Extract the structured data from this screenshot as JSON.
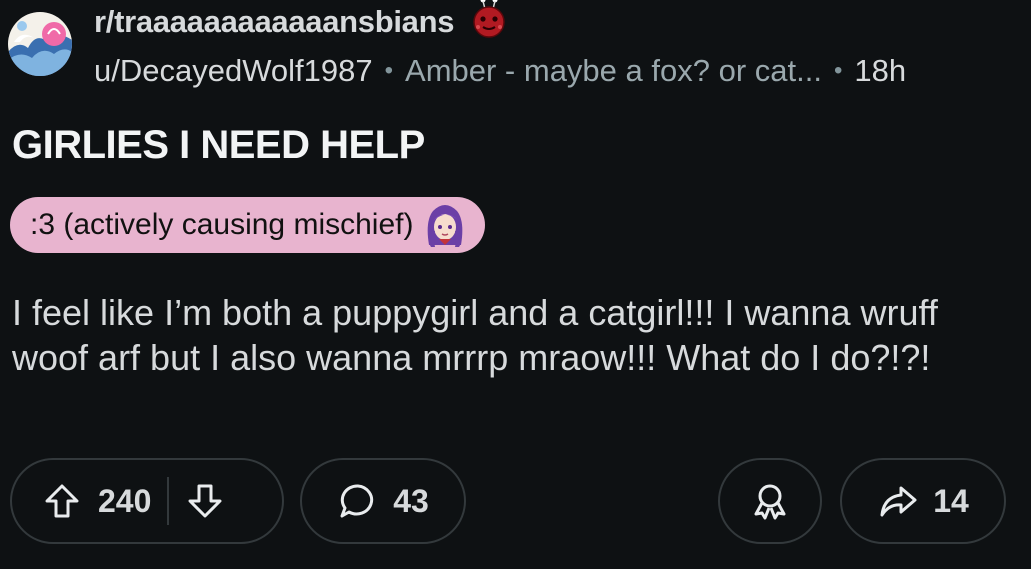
{
  "header": {
    "subreddit": "r/traaaaaaaaaaaansbians",
    "username": "u/DecayedWolf1987",
    "separator": "•",
    "user_flair": "Amber - maybe a fox? or cat...",
    "time_ago": "18h"
  },
  "post": {
    "title": "GIRLIES I NEED HELP",
    "flair": ":3 (actively causing mischief)",
    "body": "I feel like I’m both a puppygirl and a catgirl!!! I wanna wruff woof arf but I also wanna mrrrp mraow!!! What do I do?!?!"
  },
  "actions": {
    "upvotes": "240",
    "comments": "43",
    "shares": "14"
  },
  "icons": {
    "upvote": "upvote-arrow-icon",
    "downvote": "downvote-arrow-icon",
    "comment": "comment-bubble-icon",
    "award": "award-ribbon-icon",
    "share": "share-arrow-icon"
  },
  "colors": {
    "background": "#0e1113",
    "flair_background": "#e8b4cf",
    "text": "#d7dadc",
    "muted": "#9aa8ad",
    "pill_border": "#33393c"
  }
}
